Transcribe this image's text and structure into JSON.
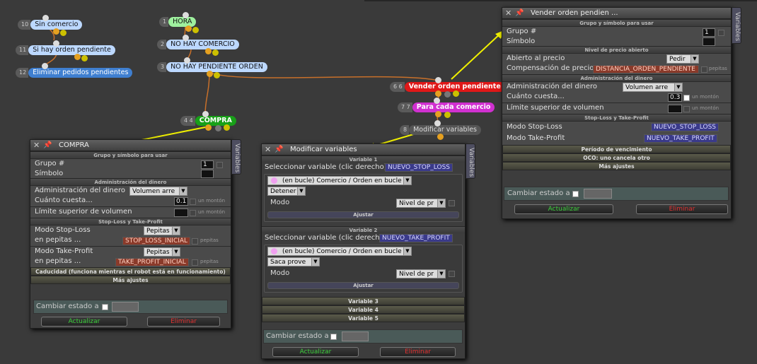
{
  "nodes": {
    "sin_comercio": {
      "num": "10",
      "label": "Sin comercio"
    },
    "si_hay_orden": {
      "num": "11",
      "label": "Si hay orden pendiente"
    },
    "eliminar": {
      "num": "12",
      "label": "Eliminar pedidos pendientes"
    },
    "hora": {
      "num": "1",
      "label": "HORA"
    },
    "no_hay_comercio": {
      "num": "2",
      "label": "NO HAY COMERCIO"
    },
    "no_hay_pendiente": {
      "num": "3",
      "label": "NO HAY PENDIENTE ORDEN"
    },
    "compra": {
      "num": "4 4",
      "label": "COMPRA"
    },
    "vender": {
      "num": "6 6",
      "label": "Vender orden pendiente"
    },
    "para_cada": {
      "num": "7 7",
      "label": "Para cada comercio"
    },
    "modificar": {
      "num": "8",
      "label": "Modificar variables"
    }
  },
  "compra_panel": {
    "title": "COMPRA",
    "tab": "Variables",
    "sec_group": "Grupo y símbolo para usar",
    "group_label": "Grupo #",
    "group_value": "1",
    "symbol_label": "Símbolo",
    "sec_money": "Administración del dinero",
    "money_label": "Administración del dinero",
    "money_value": "Volumen arre",
    "cost_label": "Cuánto cuesta...",
    "cost_value": "0.1",
    "cost_unit": "un montón",
    "limit_label": "Límite superior de volumen",
    "limit_unit": "un montón",
    "sec_sltp": "Stop-Loss y Take-Profit",
    "sl_mode_label": "Modo Stop-Loss",
    "sl_mode_value": "Pepitas fij",
    "sl_pips_label": "en pepitas ...",
    "sl_var": "STOP_LOSS_INICIAL",
    "sl_unit": "pepitas",
    "tp_mode_label": "Modo Take-Profit",
    "tp_mode_value": "Pepitas fij",
    "tp_pips_label": "en pepitas ...",
    "tp_var": "TAKE_PROFIT_INICIAL",
    "tp_unit": "pepitas",
    "sec_expiry": "Caducidad (funciona mientras el robot está en funcionamiento)",
    "sec_more": "Más ajustes",
    "state_label": "Cambiar estado a",
    "update": "Actualizar",
    "delete": "Eliminar"
  },
  "modificar_panel": {
    "title": "Modificar variables",
    "tab": "Variables",
    "var1": "Variable 1",
    "select1_label": "Seleccionar variable (clic derecho)",
    "select1_var": "NUEVO_STOP_LOSS",
    "loop1": "(en bucle) Comercio / Orden en bucle",
    "action1": "Detener la",
    "mode1_label": "Modo",
    "mode1_value": "Nivel de pr",
    "adjust1": "Ajustar",
    "var2": "Variable 2",
    "select2_label": "Seleccionar variable (clic derecho)",
    "select2_var": "NUEVO_TAKE_PROFIT",
    "loop2": "(en bucle) Comercio / Orden en bucle",
    "action2": "Saca prove",
    "mode2_label": "Modo",
    "mode2_value": "Nivel de pr",
    "adjust2": "Ajustar",
    "var3": "Variable 3",
    "var4": "Variable 4",
    "var5": "Variable 5",
    "state_label": "Cambiar estado a",
    "update": "Actualizar",
    "delete": "Eliminar"
  },
  "vender_panel": {
    "title": "Vender orden pendien ...",
    "tab": "Variables",
    "sec_group": "Grupo y símbolo para usar",
    "group_label": "Grupo #",
    "group_value": "1",
    "symbol_label": "Símbolo",
    "sec_price": "Nivel de precio abierto",
    "open_label": "Abierto al precio",
    "open_value": "Pedir",
    "offset_label": "Compensación de precio",
    "offset_var": "DISTANCIA_ORDEN_PENDIENTE",
    "offset_unit": "pepitas",
    "sec_money": "Administración del dinero",
    "money_label": "Administración del dinero",
    "money_value": "Volumen arre",
    "cost_label": "Cuánto cuesta...",
    "cost_value": "0.3",
    "cost_unit": "un montón",
    "limit_label": "Límite superior de volumen",
    "limit_unit": "un montón",
    "sec_sltp": "Stop-Loss y Take-Profit",
    "sl_label": "Modo Stop-Loss",
    "sl_var": "NUEVO_STOP_LOSS",
    "tp_label": "Modo Take-Profit",
    "tp_var": "NUEVO_TAKE_PROFIT",
    "sec_expiry": "Período de vencimiento",
    "sec_oco": "OCO: uno cancela otro",
    "sec_more": "Más ajustes",
    "state_label": "Cambiar estado a",
    "update": "Actualizar",
    "delete": "Eliminar"
  },
  "colors": {
    "accent_green": "#3ccf3c",
    "delete_red": "#e03030",
    "node_blue": "#bcd8ff",
    "node_red": "#e01818",
    "node_magenta": "#d030d0",
    "node_green": "#18a018"
  }
}
